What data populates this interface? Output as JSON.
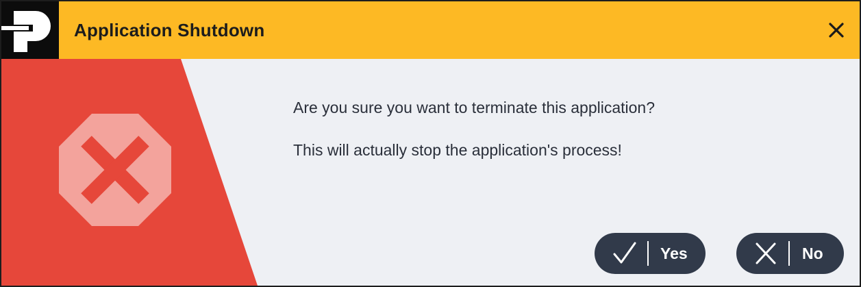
{
  "window": {
    "title": "Application Shutdown",
    "close_icon": "close-icon",
    "logo_icon": "app-logo-icon"
  },
  "message": {
    "line1": "Are you sure you want to terminate this application?",
    "line2": "This will actually stop the application's process!",
    "icon": "error-stop-icon"
  },
  "buttons": {
    "yes": {
      "label": "Yes",
      "icon": "checkmark-icon"
    },
    "no": {
      "label": "No",
      "icon": "x-mark-icon"
    }
  },
  "colors": {
    "titlebar": "#fdb924",
    "danger_panel": "#e6473a",
    "button_bg": "#313a4a",
    "content_bg": "#eef0f4",
    "text": "#2a2f3a"
  }
}
